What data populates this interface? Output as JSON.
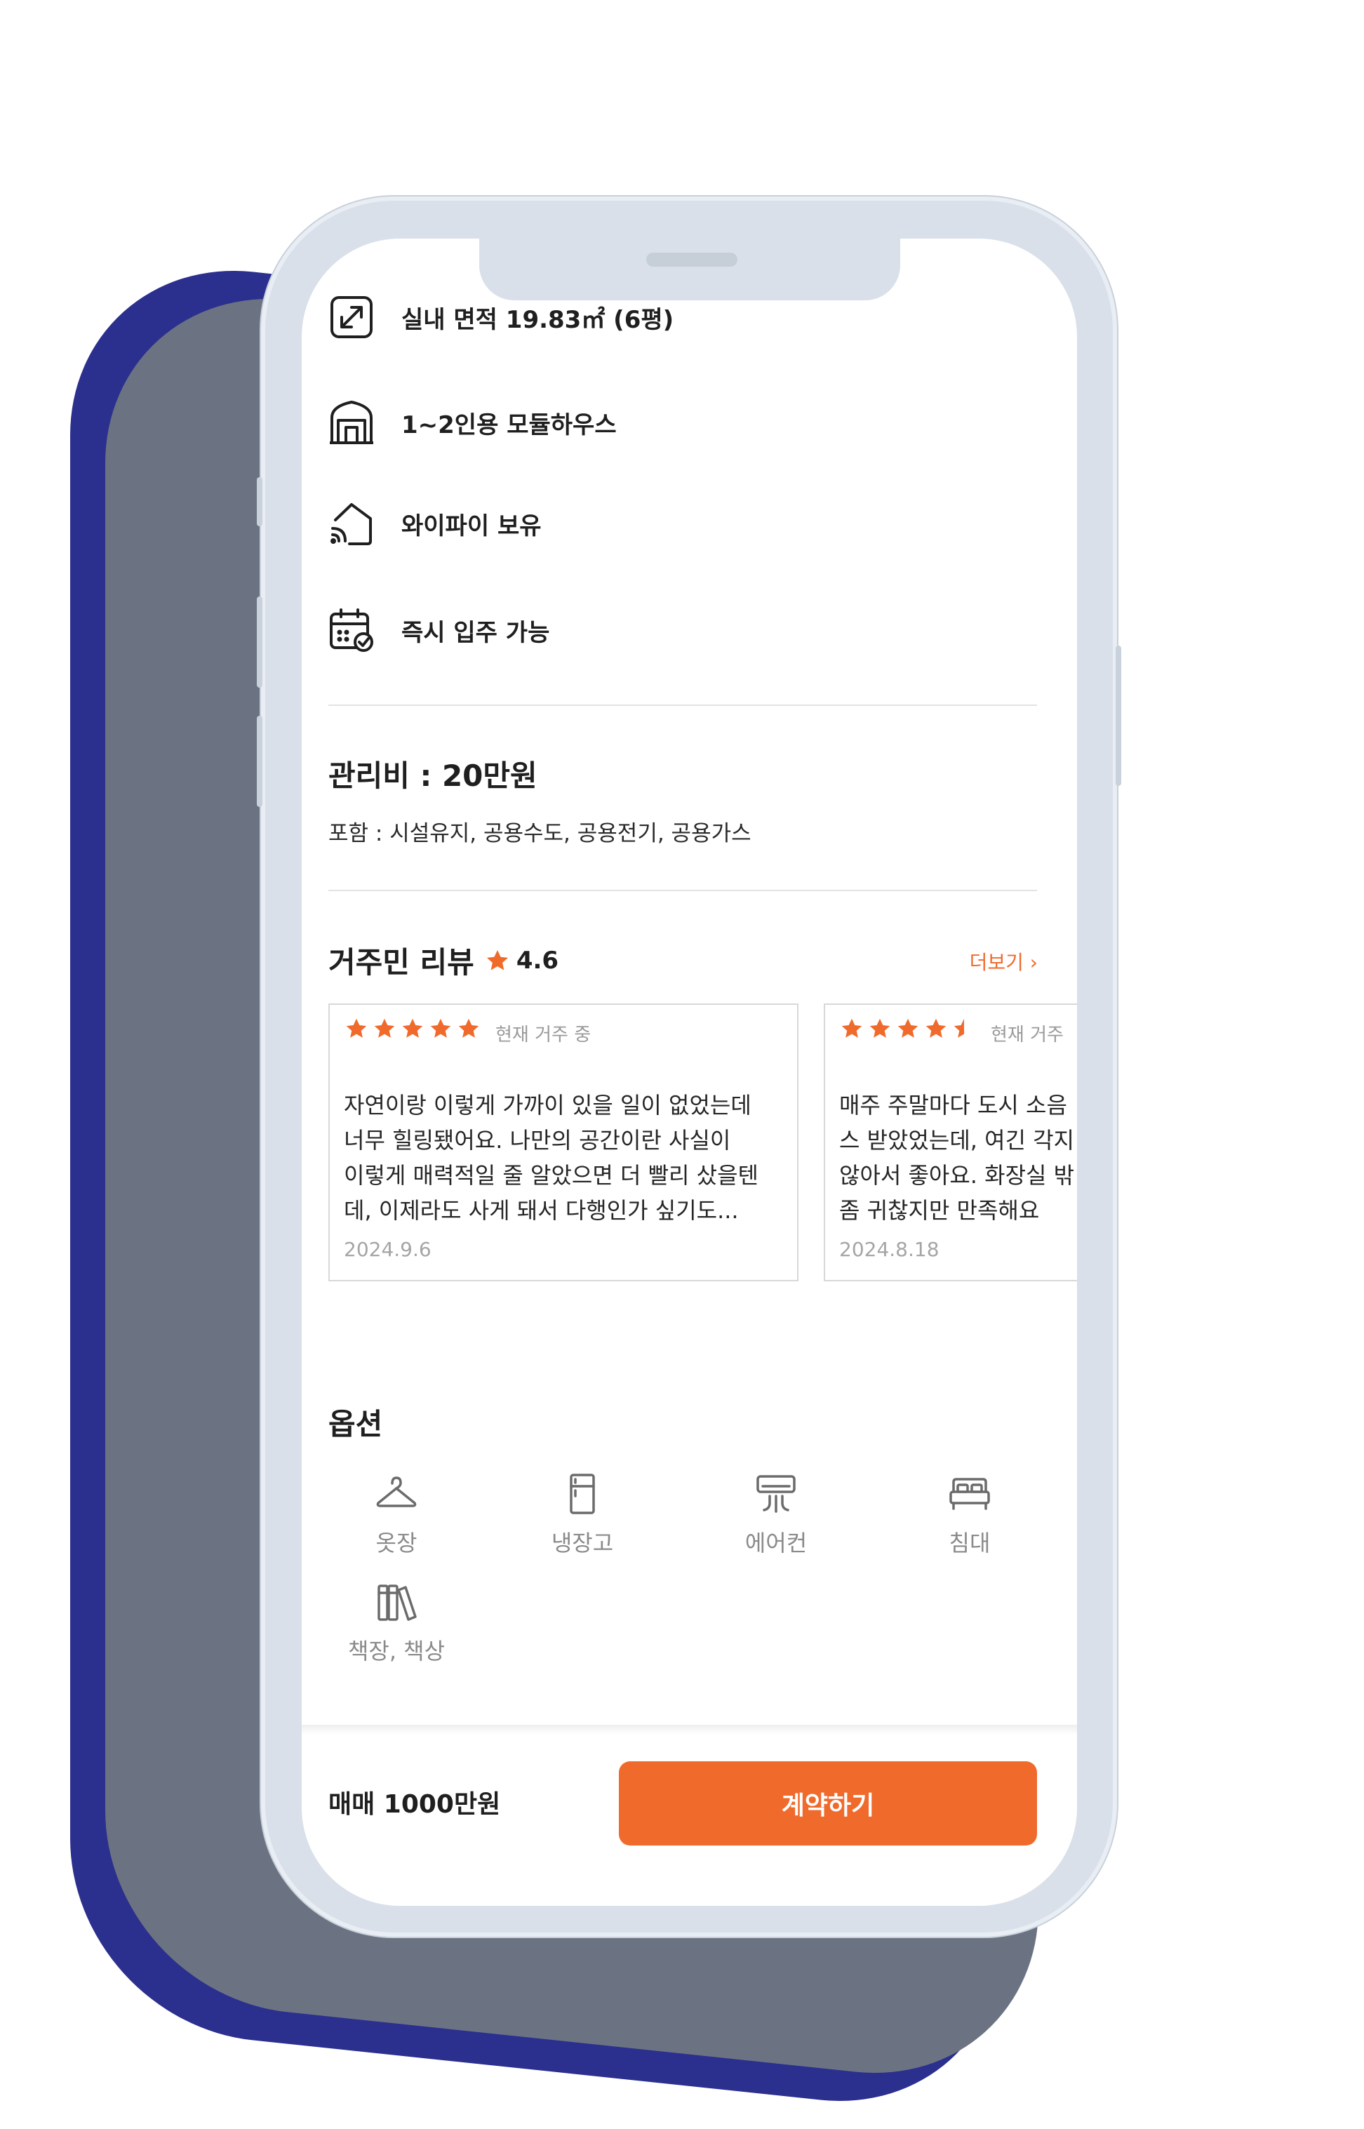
{
  "features": [
    {
      "icon": "resize-arrow-icon",
      "label": "실내 면적 19.83㎡ (6평)"
    },
    {
      "icon": "modular-house-icon",
      "label": "1~2인용 모듈하우스"
    },
    {
      "icon": "wifi-house-icon",
      "label": "와이파이 보유"
    },
    {
      "icon": "calendar-check-icon",
      "label": "즉시 입주 가능"
    }
  ],
  "fee": {
    "title": "관리비 : 20만원",
    "included": "포함 : 시설유지, 공용수도, 공용전기, 공용가스"
  },
  "reviews": {
    "title": "거주민 리뷰",
    "rating": "4.6",
    "more_label": "더보기",
    "items": [
      {
        "stars": 5,
        "status": "현재 거주 중",
        "text": "자연이랑 이렇게 가까이 있을 일이 없었는데\n너무 힐링됐어요. 나만의 공간이란 사실이\n이렇게 매력적일 줄 알았으면 더 빨리 샀을텐\n데, 이제라도 사게 돼서 다행인가 싶기도...",
        "date": "2024.9.6"
      },
      {
        "stars": 4.5,
        "status": "현재 거주",
        "text": "매주 주말마다 도시 소음\n스 받았었는데, 여긴 각지\n않아서 좋아요. 화장실 밖\n좀 귀찮지만 만족해요",
        "date": "2024.8.18"
      }
    ]
  },
  "options": {
    "title": "옵션",
    "items": [
      {
        "icon": "hanger-icon",
        "label": "옷장"
      },
      {
        "icon": "fridge-icon",
        "label": "냉장고"
      },
      {
        "icon": "air-conditioner-icon",
        "label": "에어컨"
      },
      {
        "icon": "bed-icon",
        "label": "침대"
      },
      {
        "icon": "bookshelf-icon",
        "label": "책장, 책상"
      }
    ]
  },
  "bottom_bar": {
    "price": "매매 1000만원",
    "cta_label": "계약하기"
  },
  "colors": {
    "accent": "#f06a2c",
    "phone_frame": "#d9e0ea",
    "shadow_navy": "#2b2f8e",
    "shadow_gray": "#6b7382"
  }
}
